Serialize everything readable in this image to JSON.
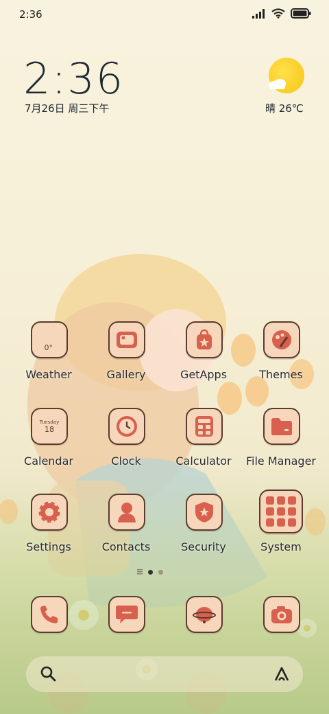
{
  "status_bar": {
    "time": "2:36",
    "icons": [
      "signal-icon",
      "wifi-icon",
      "battery-icon"
    ]
  },
  "clock_widget": {
    "time": "2:36",
    "date": "7月26日 周三下午"
  },
  "weather_widget": {
    "condition_temp": "晴 26℃",
    "icon": "sunny-cloud-icon"
  },
  "apps_row1": [
    {
      "label": "Weather",
      "icon": "weather-icon"
    },
    {
      "label": "Gallery",
      "icon": "gallery-icon"
    },
    {
      "label": "GetApps",
      "icon": "getapps-icon"
    },
    {
      "label": "Themes",
      "icon": "themes-icon"
    }
  ],
  "apps_row2": [
    {
      "label": "Calendar",
      "icon": "calendar-icon"
    },
    {
      "label": "Clock",
      "icon": "clock-icon"
    },
    {
      "label": "Calculator",
      "icon": "calculator-icon"
    },
    {
      "label": "File Manager",
      "icon": "file-manager-icon"
    }
  ],
  "apps_row3": [
    {
      "label": "Settings",
      "icon": "settings-icon"
    },
    {
      "label": "Contacts",
      "icon": "contacts-icon"
    },
    {
      "label": "Security",
      "icon": "security-icon"
    },
    {
      "label": "System",
      "icon": "system-folder-icon"
    }
  ],
  "weather_tile": {
    "temp": "0°"
  },
  "calendar_tile": {
    "weekday": "Tuesday",
    "day": "18"
  },
  "dock": [
    {
      "icon": "phone-icon"
    },
    {
      "icon": "messages-icon"
    },
    {
      "icon": "browser-icon"
    },
    {
      "icon": "camera-icon"
    }
  ],
  "search_bar": {
    "left_icon": "search-icon",
    "right_icon": "assistant-icon"
  },
  "colors": {
    "tile_bg": "#f7d7bb",
    "tile_border": "#5a3b2c",
    "icon_red": "#d8604f"
  }
}
